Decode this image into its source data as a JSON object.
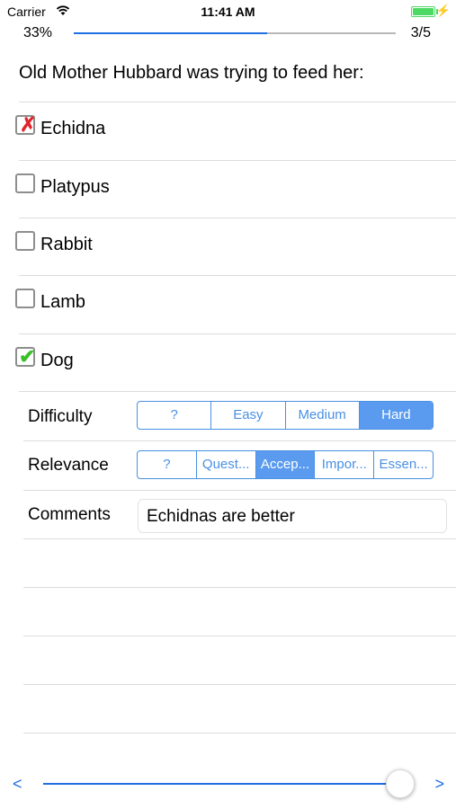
{
  "status_bar": {
    "carrier": "Carrier",
    "time": "11:41 AM",
    "wifi_icon": "wifi-icon",
    "battery_icon": "battery-icon",
    "charging_icon": "charging-bolt-icon",
    "battery_color": "#4cd964"
  },
  "progress": {
    "percent_label": "33%",
    "fraction": 0.6,
    "counter": "3/5",
    "accent": "#1f6fe0"
  },
  "question": "Old Mother Hubbard was trying to feed her:",
  "options": [
    {
      "label": "Echidna",
      "state": "cross"
    },
    {
      "label": "Platypus",
      "state": "empty"
    },
    {
      "label": "Rabbit",
      "state": "empty"
    },
    {
      "label": "Lamb",
      "state": "empty"
    },
    {
      "label": "Dog",
      "state": "tick"
    }
  ],
  "difficulty": {
    "label": "Difficulty",
    "segments": [
      "?",
      "Easy",
      "Medium",
      "Hard"
    ],
    "selected": 3
  },
  "relevance": {
    "label": "Relevance",
    "segments": [
      "?",
      "Quest...",
      "Accep...",
      "Impor...",
      "Essen..."
    ],
    "selected": 2
  },
  "comments": {
    "label": "Comments",
    "value": "Echidnas are better"
  },
  "navigation": {
    "prev": "<",
    "next": ">",
    "slider_fraction": 1.0
  }
}
